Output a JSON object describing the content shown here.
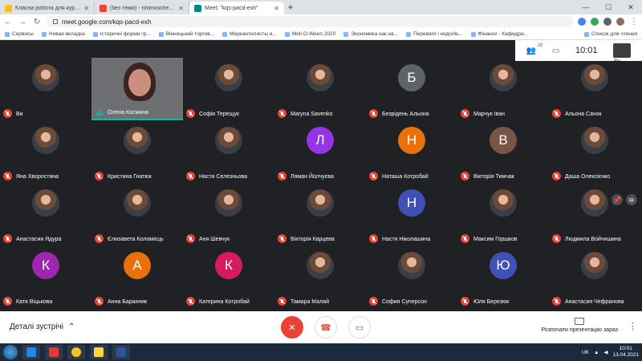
{
  "browser": {
    "tabs": [
      {
        "label": "Класна робота для курсу \"Бані\"",
        "color": "#f6bf26",
        "active": false
      },
      {
        "label": "(без теми) - nhimoschenkom@g",
        "color": "#ea4335",
        "active": false
      },
      {
        "label": "Meet: \"kqs-pacd-exh\"",
        "color": "#00897b",
        "active": true
      }
    ],
    "new_tab": "+",
    "url": "meet.google.com/kqs-pacd-exh",
    "bookmarks": [
      "Сервисы",
      "Новая вкладка",
      "Історичні форми гр...",
      "Вінницький торгов...",
      "Меркантилисты и...",
      "Mell-O-Ween 2020",
      "Экономика как на...",
      "Переваги і недолік...",
      "Фінанси - Кафедра..."
    ],
    "reading_list": "Список для чтения"
  },
  "meet": {
    "participants_count": "28",
    "time": "10:01",
    "self_label": "Ви",
    "participants": [
      {
        "name": "Ви",
        "kind": "photo"
      },
      {
        "name": "Олена Космина",
        "kind": "video"
      },
      {
        "name": "Софія Терещук",
        "kind": "photo"
      },
      {
        "name": "Maryna Savenko",
        "kind": "photo"
      },
      {
        "name": "Безрідень Альона",
        "kind": "letter",
        "letter": "Б",
        "color": "#5f6368"
      },
      {
        "name": "Марчук Іван",
        "kind": "photo"
      },
      {
        "name": "Альона Сачок",
        "kind": "photo"
      },
      {
        "name": "Яна Хворостяна",
        "kind": "photo"
      },
      {
        "name": "Кристина Гнатюк",
        "kind": "photo"
      },
      {
        "name": "Настя Селезньова",
        "kind": "photo"
      },
      {
        "name": "Ляман Йолчуєва",
        "kind": "letter",
        "letter": "Л",
        "color": "#9334e6"
      },
      {
        "name": "Наташа Котробай",
        "kind": "letter",
        "letter": "Н",
        "color": "#e8710a"
      },
      {
        "name": "Вікторія Тимчак",
        "kind": "letter",
        "letter": "В",
        "color": "#795548"
      },
      {
        "name": "Даша Олексієнко",
        "kind": "photo"
      },
      {
        "name": "Анастасия Ядура",
        "kind": "photo"
      },
      {
        "name": "Єлизавета Коломієць",
        "kind": "photo"
      },
      {
        "name": "Аня Шевчук",
        "kind": "photo"
      },
      {
        "name": "Вікторія Карцева",
        "kind": "photo"
      },
      {
        "name": "Настя Ніколашина",
        "kind": "letter",
        "letter": "Н",
        "color": "#3f51b5"
      },
      {
        "name": "Максим Горшков",
        "kind": "photo"
      },
      {
        "name": "Людмила Войчишина",
        "kind": "photo"
      },
      {
        "name": "Катя Віцькова",
        "kind": "letter",
        "letter": "К",
        "color": "#9c27b0"
      },
      {
        "name": "Анна Баранник",
        "kind": "letter",
        "letter": "А",
        "color": "#e8710a"
      },
      {
        "name": "Катерина Котробай",
        "kind": "letter",
        "letter": "К",
        "color": "#d81b60"
      },
      {
        "name": "Тамара Малай",
        "kind": "photo"
      },
      {
        "name": "София Суперсон",
        "kind": "photo"
      },
      {
        "name": "Юля Березюк",
        "kind": "letter",
        "letter": "Ю",
        "color": "#3f51b5"
      },
      {
        "name": "Анастасия Чефранова",
        "kind": "photo"
      }
    ],
    "details_label": "Деталі зустрічі",
    "present_label": "Розпочати презентацію зараз"
  },
  "taskbar": {
    "lang": "UK",
    "time": "10:01",
    "date": "13.04.2021"
  }
}
